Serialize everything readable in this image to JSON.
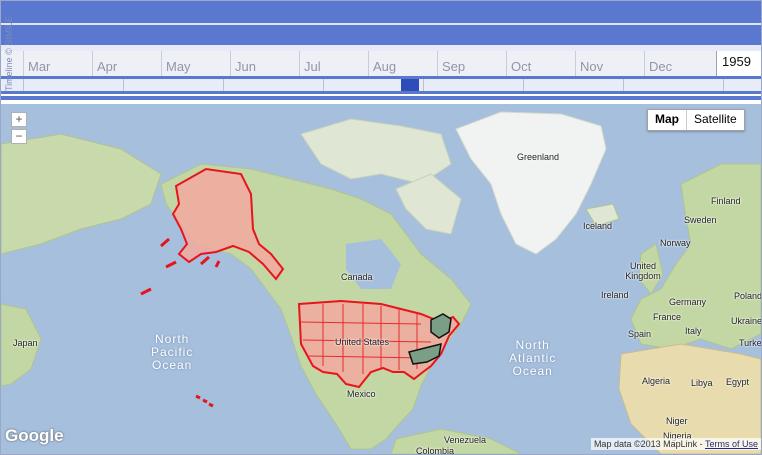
{
  "timeline": {
    "credit": "Timeline © SIMILE",
    "months": [
      "Mar",
      "Apr",
      "May",
      "Jun",
      "Jul",
      "Aug",
      "Sep",
      "Oct",
      "Nov",
      "Dec"
    ],
    "year": "1959",
    "colors": {
      "band": "#5a78d0",
      "highlight": "#2f4db8"
    }
  },
  "map": {
    "zoom_in": "+",
    "zoom_out": "−",
    "type_map": "Map",
    "type_satellite": "Satellite",
    "labels": {
      "greenland": "Greenland",
      "iceland": "Iceland",
      "finland": "Finland",
      "sweden": "Sweden",
      "norway": "Norway",
      "uk": "United Kingdom",
      "ireland": "Ireland",
      "poland": "Poland",
      "germany": "Germany",
      "ukraine": "Ukraine",
      "france": "France",
      "italy": "Italy",
      "spain": "Spain",
      "turkey": "Turkey",
      "algeria": "Algeria",
      "libya": "Libya",
      "egypt": "Egypt",
      "niger": "Niger",
      "nigeria": "Nigeria",
      "canada": "Canada",
      "usa": "United States",
      "mexico": "Mexico",
      "venezuela": "Venezuela",
      "colombia": "Colombia",
      "japan": "Japan"
    },
    "oceans": {
      "north_pacific": [
        "North",
        "Pacific",
        "Ocean"
      ],
      "north_atlantic": [
        "North",
        "Atlantic",
        "Ocean"
      ]
    },
    "logo": "Google",
    "attribution": "Map data ©2013 MapLink - ",
    "terms": "Terms of Use",
    "colors": {
      "water": "#a6bfdd",
      "land": "#c3d7a4",
      "highlight_fill": "#f2a9a0",
      "highlight_stroke": "#e8141c",
      "selected_fill": "#7a9e86"
    }
  }
}
